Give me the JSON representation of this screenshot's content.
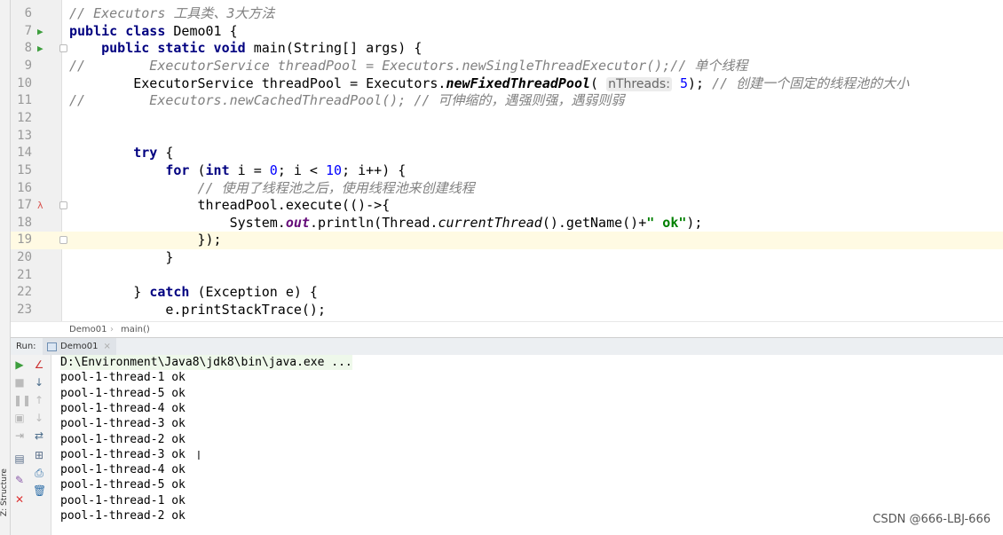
{
  "editor": {
    "lines": [
      {
        "n": "6",
        "tokens": [
          {
            "t": "// Executors 工具类、3大方法",
            "c": "cm"
          }
        ]
      },
      {
        "n": "7",
        "run": true,
        "tokens": [
          {
            "t": "public class ",
            "c": "kw"
          },
          {
            "t": "Demo01 {",
            "c": ""
          }
        ]
      },
      {
        "n": "8",
        "run": true,
        "fold": true,
        "tokens": [
          {
            "t": "    public static void ",
            "c": "kw"
          },
          {
            "t": "main(String[] args) {",
            "c": ""
          }
        ]
      },
      {
        "n": "9",
        "tokens": [
          {
            "t": "//        ExecutorService threadPool = Executors.newSingleThreadExecutor();// 单个线程",
            "c": "cm"
          }
        ]
      },
      {
        "n": "10",
        "tokens": [
          {
            "t": "        ExecutorService threadPool = Executors.",
            "c": ""
          },
          {
            "t": "newFixedThreadPool",
            "c": "itb"
          },
          {
            "t": "( ",
            "c": ""
          },
          {
            "t": "nThreads:",
            "c": "hint"
          },
          {
            "t": " ",
            "c": ""
          },
          {
            "t": "5",
            "c": "num"
          },
          {
            "t": "); ",
            "c": ""
          },
          {
            "t": "// 创建一个固定的线程池的大小",
            "c": "cm"
          }
        ]
      },
      {
        "n": "11",
        "tokens": [
          {
            "t": "//        Executors.newCachedThreadPool(); // 可伸缩的，遇强则强，遇弱则弱",
            "c": "cm"
          }
        ]
      },
      {
        "n": "12",
        "tokens": []
      },
      {
        "n": "13",
        "tokens": []
      },
      {
        "n": "14",
        "tokens": [
          {
            "t": "        try ",
            "c": "kw"
          },
          {
            "t": "{",
            "c": ""
          }
        ]
      },
      {
        "n": "15",
        "tokens": [
          {
            "t": "            for ",
            "c": "kw"
          },
          {
            "t": "(",
            "c": ""
          },
          {
            "t": "int ",
            "c": "kw"
          },
          {
            "t": "i = ",
            "c": ""
          },
          {
            "t": "0",
            "c": "num"
          },
          {
            "t": "; i < ",
            "c": ""
          },
          {
            "t": "10",
            "c": "num"
          },
          {
            "t": "; i++) {",
            "c": ""
          }
        ]
      },
      {
        "n": "16",
        "tokens": [
          {
            "t": "                // 使用了线程池之后，使用线程池来创建线程",
            "c": "cm"
          }
        ]
      },
      {
        "n": "17",
        "lambda": true,
        "fold": true,
        "tokens": [
          {
            "t": "                threadPool.execute(()->{",
            "c": ""
          }
        ]
      },
      {
        "n": "18",
        "tokens": [
          {
            "t": "                    System.",
            "c": ""
          },
          {
            "t": "out",
            "c": "fld"
          },
          {
            "t": ".println(Thread.",
            "c": ""
          },
          {
            "t": "currentThread",
            "c": "it"
          },
          {
            "t": "().getName()+",
            "c": ""
          },
          {
            "t": "\" ok\"",
            "c": "str"
          },
          {
            "t": ");",
            "c": ""
          }
        ]
      },
      {
        "n": "19",
        "hl": true,
        "fold": true,
        "tokens": [
          {
            "t": "                });",
            "c": ""
          }
        ]
      },
      {
        "n": "20",
        "tokens": [
          {
            "t": "            }",
            "c": ""
          }
        ]
      },
      {
        "n": "21",
        "tokens": []
      },
      {
        "n": "22",
        "tokens": [
          {
            "t": "        } ",
            "c": ""
          },
          {
            "t": "catch ",
            "c": "kw"
          },
          {
            "t": "(Exception e) {",
            "c": ""
          }
        ]
      },
      {
        "n": "23",
        "tokens": [
          {
            "t": "            e.printStackTrace();",
            "c": ""
          }
        ]
      }
    ]
  },
  "breadcrumb": {
    "class": "Demo01",
    "sep": "›",
    "method": "main()"
  },
  "run": {
    "label": "Run:",
    "tab": "Demo01",
    "close": "×"
  },
  "console": {
    "command": "D:\\Environment\\Java8\\jdk8\\bin\\java.exe ...",
    "output": [
      "pool-1-thread-1 ok",
      "pool-1-thread-5 ok",
      "pool-1-thread-4 ok",
      "pool-1-thread-3 ok",
      "pool-1-thread-2 ok",
      "pool-1-thread-3 ok",
      "pool-1-thread-4 ok",
      "pool-1-thread-5 ok",
      "pool-1-thread-1 ok",
      "pool-1-thread-2 ok"
    ]
  },
  "sidebar": {
    "structure": "Z: Structure"
  },
  "watermark": "CSDN @666-LBJ-666",
  "colors": {
    "keyword": "#000080",
    "comment": "#808080",
    "number": "#0000ff",
    "string": "#008000",
    "highlight": "#fffae3"
  }
}
